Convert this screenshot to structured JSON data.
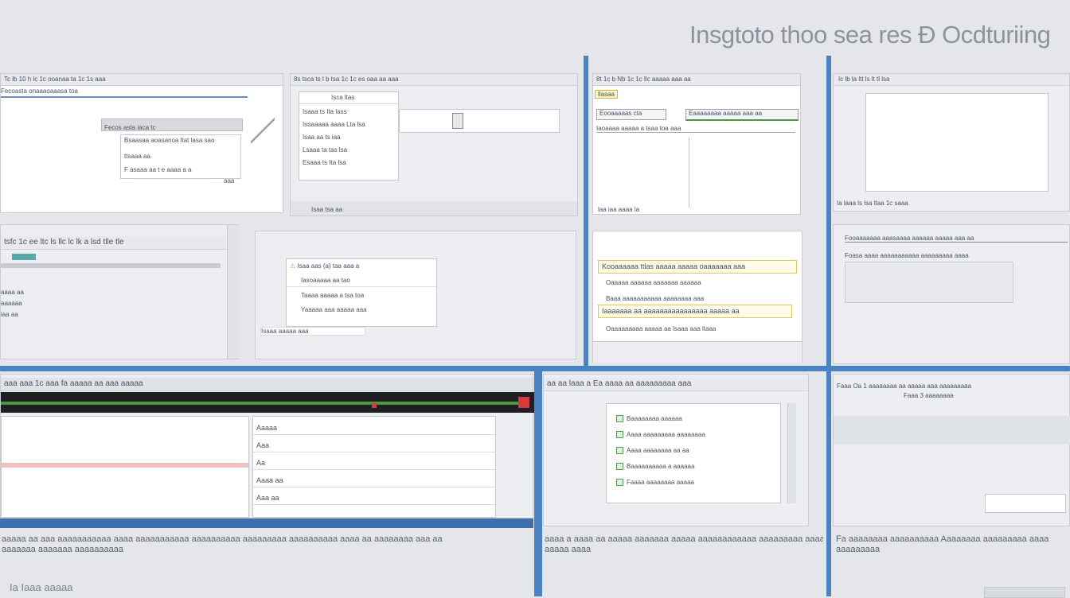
{
  "page": {
    "title": "Insgtoto thoo sea res Ð Ocdturiing"
  },
  "colors": {
    "accent_blue": "#4b82c4",
    "highlight_yellow": "#e0c85a",
    "progress_green": "#4c9a3c",
    "alert_red": "#d63b3b"
  },
  "panel_a": {
    "toolbar": "Tc lb 10 h lc 1c ooanaa ta 1c 1s aaa",
    "field": "Fecoasta onaaaoaaasa toa",
    "dialog_title": "Fecos asta iaca tc",
    "dialog_line1": "Bsaasaa aoasanoa ltat lasa sao",
    "dialog_line2": "ttsaaa aa",
    "dialog_line3": "F asaaa aa t e aaaa a a",
    "corner_label": "aaa"
  },
  "panel_b": {
    "toolbar": "8s tsca ts l b tsa 1c 1c es oaa aa aaa",
    "list_header": "Isca ltas",
    "items": [
      "Isaaa ts Ita lass",
      "Isoaaaaa aaaa Lta lsa",
      "Isaa aa ts iaa",
      "Lsaaa ta tas lsa",
      "Esaaa ts Ita lsa"
    ],
    "footer": "Isaa tsa aa"
  },
  "panel_c": {
    "toolbar": "8t 1c b Nb 1c 1c llc aaaaa aaa aa",
    "tag": "llasaa",
    "row1": "Eooaaaaas cta",
    "row2": "Eaaaaaaaa aaaaa aaa aa",
    "row3": "Iaoaaaa aaaaa a tsaa toa aaa",
    "footer": "laa iaa aaaa la"
  },
  "panel_d": {
    "toolbar": "Ic lb la ltt ls lt tl lsa",
    "footer": "Ia laaa ls lsa tlaa 1c saaa",
    "bottom_bar": "Fooaaaaaaa aaasaaaa aaaaaa aaaaa aaa aa",
    "bottom_bar2": "Foasa aaaa aaaaaaaaaaa aaaaaaaaa aaaa"
  },
  "panel_e": {
    "toolbar": "tsfc 1c ee ltc ls llc lc lk a lsd tlle tle",
    "icons_row": "1ia",
    "status_lines": [
      "aaaa aa",
      "aaaaaa",
      "iaa aa"
    ]
  },
  "panel_f": {
    "items": [
      "Isaa aas (a) taa aaa a",
      "Iasoaaaaa aa tao",
      "Taaaa aaaaa a tsa toa",
      "Yaaaaa aaa aaaaa aaa",
      "Isaaa aaaaa aaa"
    ]
  },
  "panel_g": {
    "items": [
      "Kooaaaaaa ttlas aaaaa aaaaa oaaaaaaa aaa",
      "Oaaaaa aaaaaa aaaaaaa aaaaaa",
      "Baaa aaaaaaaaaaa aaaaaaaa aaa",
      "Iaaaaaaa aa aaaaaaaaaaaaaaaa aaaaa aa",
      "Oaaaaaaaaa aaaaa aa lsaaa aaa ltaaa"
    ]
  },
  "panel_h": {
    "header": "aaaa aaaaaaa aaaaaa aaaaaaa aaaaaaa",
    "line1": "Taaa aaaaaaaaa aaaaaaaa aaaaa aaa",
    "footer": "Ta aa aa aaaa aaaa aaa aaaa aaaaa"
  },
  "panel_i": {
    "toolbar": "aaa aaa 1c aaa fa aaaaa aa aaa aaaaa",
    "rows": [
      "Aaaaa",
      "Aaa",
      "Aa",
      "Aaaa aa",
      "Aaa aa"
    ]
  },
  "panel_j": {
    "toolbar": "aa aa laaa a Ea aaaa aa aaaaaaaaa aaa",
    "rows": [
      "Baaaaaaaa aaaaaa",
      "Aaaa aaaaaaaaa aaaaaaaa",
      "Aaaa aaaaaaaa aa aa",
      "Baaaaaaaaaa a aaaaaa",
      "Faaaa aaaaaaaa aaaaa"
    ]
  },
  "panel_k": {
    "header": "Faaa Oa 1 aaaaaaaa aa aaaaa aaa aaaaaaaaa",
    "subheader": "Faaa 3 aaaaaaaa"
  },
  "captions": {
    "left": "aaaaa aa aaa aaaaaaaaaaa aaaa aaaaaaaaaaa aaaaaaaaaa aaaaaaaaa aaaaaaaaaa aaaa aa aaaaaaaa aaa aa",
    "left2": "aaaaaaa aaaaaaa aaaaaaaaaa",
    "mid": "aaaa a aaaa aa aaaaa aaaaaaa aaaaa aaaaaaaaaaaa aaaaaaaaa aaaa aa",
    "mid2": "aaaaa aaaa",
    "right": "Fa aaaaaaaa aaaaaaaaaa Aaaaaaaa aaaaaaaaa aaaa",
    "right2": "aaaaaaaaa",
    "bottom_left": "Ia Iaaa aaaaa"
  }
}
